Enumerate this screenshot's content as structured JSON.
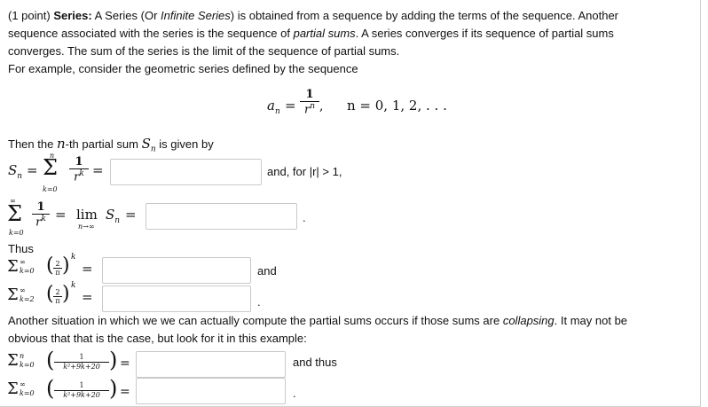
{
  "intro": {
    "point_label": "(1 point)",
    "series_label": "Series:",
    "line1_rest": " A Series (Or ",
    "infinite_series": "Infinite Series",
    "line1_tail": ") is obtained from a sequence by adding the terms of the sequence. Another",
    "line2_a": "sequence associated with the series is the sequence of ",
    "partial_sums": "partial sums",
    "line2_b": ". A series converges if its sequence of partial sums",
    "line3": "converges. The sum of the series is the limit of the sequence of partial sums.",
    "line4": "For example, consider the geometric series defined by the sequence"
  },
  "sequence": {
    "a_n": "a",
    "n_sub": "n",
    "eq": "=",
    "num": "1",
    "den_r": "r",
    "den_n": "n",
    "comma": ",",
    "n_range": "n = 0, 1, 2, . . ."
  },
  "partial": {
    "text_a": "Then the ",
    "n_var": "n",
    "text_b": "-th partial sum ",
    "S_n": "S",
    "S_sub": "n",
    "text_c": " is given by",
    "sum_top": "n",
    "sum_bottom": "k=0",
    "frac_num": "1",
    "frac_den_r": "r",
    "frac_den_k": "k",
    "and_for": "and, for |r| > 1,"
  },
  "limit": {
    "sum_top": "∞",
    "sum_bottom": "k=0",
    "frac_num": "1",
    "frac_den": "r",
    "frac_den_k": "k",
    "lim_word": "lim",
    "lim_sub": "n→∞",
    "S": "S",
    "S_sub": "n",
    "eq": "=",
    "period": "."
  },
  "thus": {
    "label": "Thus",
    "row1_lower": "k=0",
    "row1_upper": "∞",
    "row1_num": "2",
    "row1_den": "π",
    "row1_pow": "k",
    "row1_after": "and",
    "row2_lower": "k=2",
    "row2_upper": "∞",
    "row2_num": "2",
    "row2_den": "π",
    "row2_pow": "k",
    "row2_after": "."
  },
  "collapse": {
    "line1_a": "Another situation in which we we can actually compute the partial sums occurs if those sums are ",
    "collapsing": "collapsing",
    "line1_b": ". It may not be",
    "line2": "obvious that that is the case, but look for it in this example:",
    "row1_upper": "n",
    "row1_lower": "k=0",
    "row1_num": "1",
    "row1_den": "k²+9k+20",
    "row1_after": "and thus",
    "row2_upper": "∞",
    "row2_lower": "k=0",
    "row2_num": "1",
    "row2_den": "k²+9k+20",
    "row2_after": "."
  },
  "answers": {
    "partial_sum": "",
    "limit": "",
    "thus_row1": "",
    "thus_row2": "",
    "collapse_row1": "",
    "collapse_row2": ""
  }
}
